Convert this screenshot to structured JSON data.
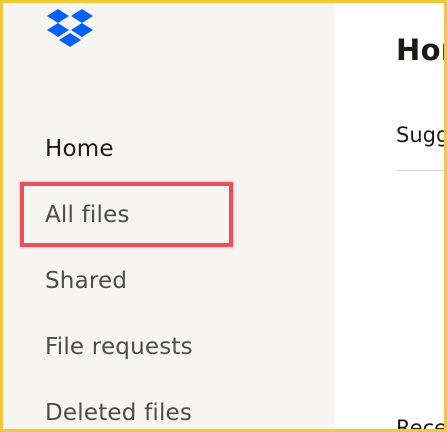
{
  "brand": {
    "logo_icon": "dropbox-logo-icon",
    "color": "#0061fe"
  },
  "sidebar": {
    "items": [
      {
        "label": "Home"
      },
      {
        "label": "All files"
      },
      {
        "label": "Shared"
      },
      {
        "label": "File requests"
      },
      {
        "label": "Deleted files"
      }
    ]
  },
  "main": {
    "title": "Hor",
    "suggested_label": "Sugg",
    "recent_label": "Rece"
  },
  "colors": {
    "highlight": "#e8505b",
    "frame_border": "#f2c83b",
    "sidebar_bg": "#f7f5f2"
  }
}
